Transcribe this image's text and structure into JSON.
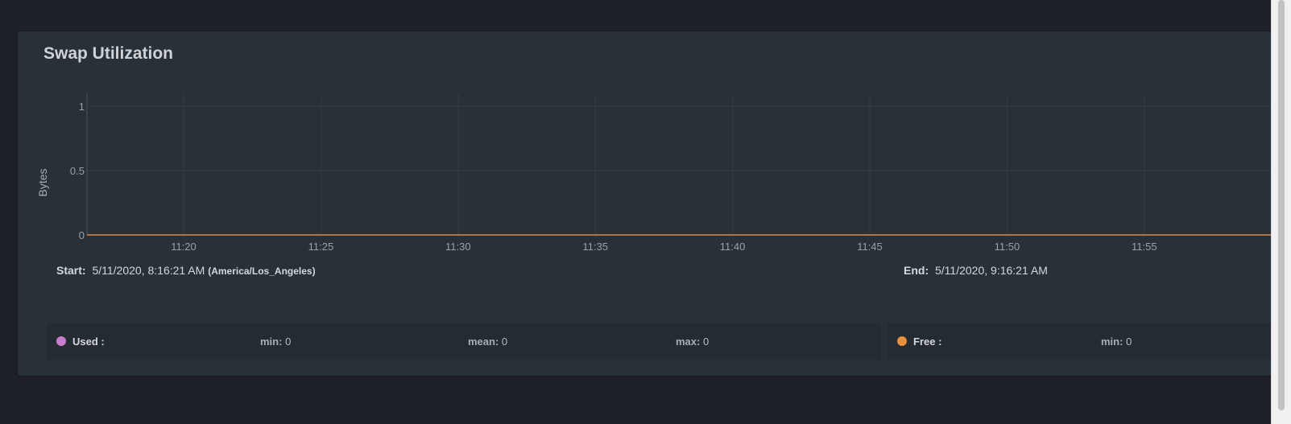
{
  "panel": {
    "title": "Swap Utilization"
  },
  "range": {
    "start_label": "Start:",
    "start_value": "5/11/2020, 8:16:21 AM",
    "start_tz": "(America/Los_Angeles)",
    "end_label": "End:",
    "end_value": "5/11/2020, 9:16:21 AM"
  },
  "legend": {
    "used": {
      "name": "Used :",
      "color": "#c77dce",
      "min_label": "min:",
      "min": "0",
      "mean_label": "mean:",
      "mean": "0",
      "max_label": "max:",
      "max": "0"
    },
    "free": {
      "name": "Free :",
      "color": "#e88f3d",
      "min_label": "min:",
      "min": "0"
    }
  },
  "chart_data": {
    "type": "line",
    "ylabel": "Bytes",
    "xlabel": "",
    "ylim": [
      0,
      1
    ],
    "yticks": [
      "0",
      "0.5",
      "1"
    ],
    "xticks": [
      "11:20",
      "11:25",
      "11:30",
      "11:35",
      "11:40",
      "11:45",
      "11:50",
      "11:55"
    ],
    "grid": true,
    "series": [
      {
        "name": "Used",
        "color": "#c77dce",
        "values": [
          0,
          0,
          0,
          0,
          0,
          0,
          0,
          0
        ]
      },
      {
        "name": "Free",
        "color": "#e88f3d",
        "values": [
          0,
          0,
          0,
          0,
          0,
          0,
          0,
          0
        ]
      }
    ]
  }
}
